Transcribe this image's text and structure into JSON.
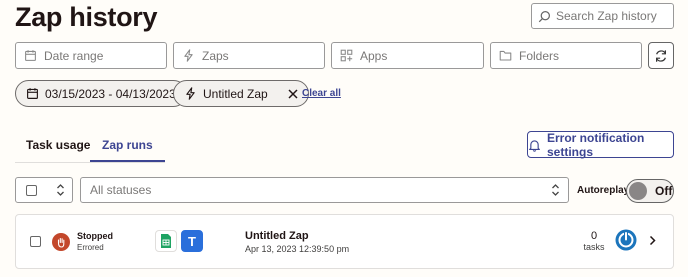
{
  "page": {
    "title": "Zap history"
  },
  "search": {
    "placeholder": "Search Zap history"
  },
  "filters": {
    "date_range": "Date range",
    "zaps": "Zaps",
    "apps": "Apps",
    "folders": "Folders"
  },
  "active_filters": {
    "date": "03/15/2023 - 04/13/2023",
    "zap": "Untitled Zap",
    "clear_all": "Clear all"
  },
  "tabs": [
    {
      "label": "Task usage",
      "active": false
    },
    {
      "label": "Zap runs",
      "active": true
    }
  ],
  "error_button": {
    "label": "Error notification settings"
  },
  "status_filter": {
    "placeholder": "All statuses"
  },
  "autoreplay": {
    "label": "Autoreplay",
    "state": "Off"
  },
  "runs": [
    {
      "status": "Stopped",
      "substatus": "Errored",
      "status_color": "#c3472b",
      "apps": [
        "google-sheets-icon",
        "text-t-icon"
      ],
      "zap_name": "Untitled Zap",
      "timestamp": "Apr 13, 2023 12:39:50 pm",
      "tasks_count": "0",
      "tasks_label": "tasks"
    }
  ],
  "colors": {
    "accent": "#3d4592",
    "background": "#fffdf9",
    "sheets_green": "#1ea362",
    "t_blue": "#2a6fdb",
    "power_blue": "#1c75bc"
  }
}
